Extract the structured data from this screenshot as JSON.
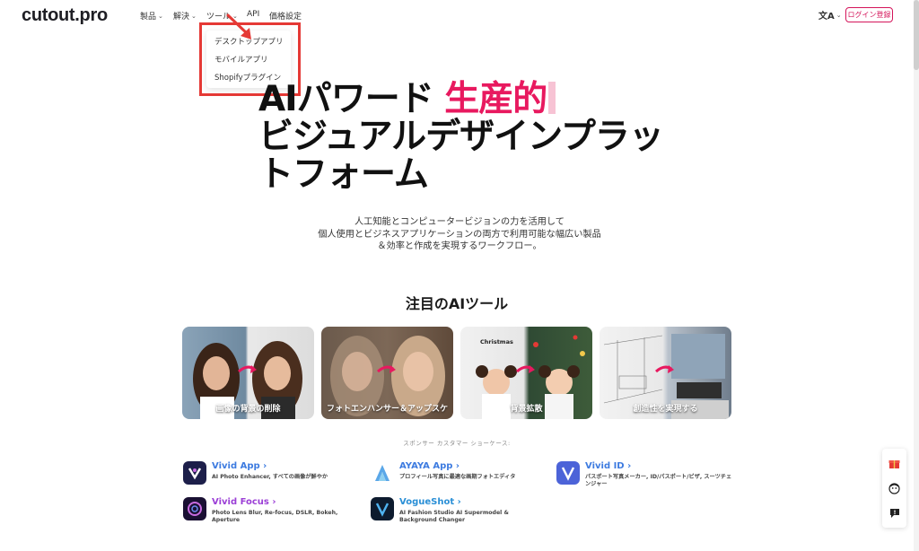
{
  "brand": {
    "logo": "cutout.pro"
  },
  "nav": {
    "items": [
      {
        "label": "製品"
      },
      {
        "label": "解決"
      },
      {
        "label": "ツール"
      },
      {
        "label": "API"
      },
      {
        "label": "価格設定"
      }
    ],
    "language_icon": "文A",
    "login_label": "ログイン登録"
  },
  "dropdown": {
    "items": [
      {
        "label": "デスクトップアプリ"
      },
      {
        "label": "モバイルアプリ"
      },
      {
        "label": "Shopifyプラグイン"
      }
    ]
  },
  "hero": {
    "line1_prefix": "AIパワード",
    "line1_accent": "生産的",
    "line2": "ビジュアルデザインプラッ",
    "line3": "トフォーム",
    "subtitle": [
      "人工知能とコンピュータービジョンの力を活用して",
      "個人使用とビジネスアプリケーションの両方で利用可能な幅広い製品",
      "＆効率と作成を実現するワークフロー。"
    ]
  },
  "featured": {
    "title": "注目のAIツール",
    "cards": [
      {
        "label": "画像の背景の削除"
      },
      {
        "label": "フォトエンハンサー＆アップスケ"
      },
      {
        "label": "背景拡散",
        "badge": "Christmas"
      },
      {
        "label": "創造性を実現する"
      }
    ]
  },
  "sponsor": {
    "label": "スポンサー カスタマー ショーケース:"
  },
  "apps": [
    {
      "name": "Vivid App",
      "desc": "AI Photo Enhancer, すべての画像が鮮やか",
      "color": "#3d7be0"
    },
    {
      "name": "AYAYA App",
      "desc": "プロフィール写真に最適な画期フォトエディタ",
      "color": "#3d7be0"
    },
    {
      "name": "Vivid ID",
      "desc": "パスポート写真メーカー, ID/パスポート/ビザ, スーツチェンジャー",
      "color": "#3d7be0"
    },
    {
      "name": "Vivid Focus",
      "desc": "Photo Lens Blur, Re-focus, DSLR, Bokeh, Aperture",
      "color": "#9b3fd6"
    },
    {
      "name": "VogueShot",
      "desc": "AI Fashion Studio AI Supermodel & Background Changer",
      "color": "#2a8fd6"
    }
  ],
  "colors": {
    "accent": "#e8195f",
    "brand_pink": "#d4145a",
    "highlight_red": "#e53935"
  },
  "icons": [
    "chevron-down-icon",
    "translate-icon",
    "gift-icon",
    "avatar-icon",
    "feedback-icon",
    "arrow-right-icon"
  ]
}
